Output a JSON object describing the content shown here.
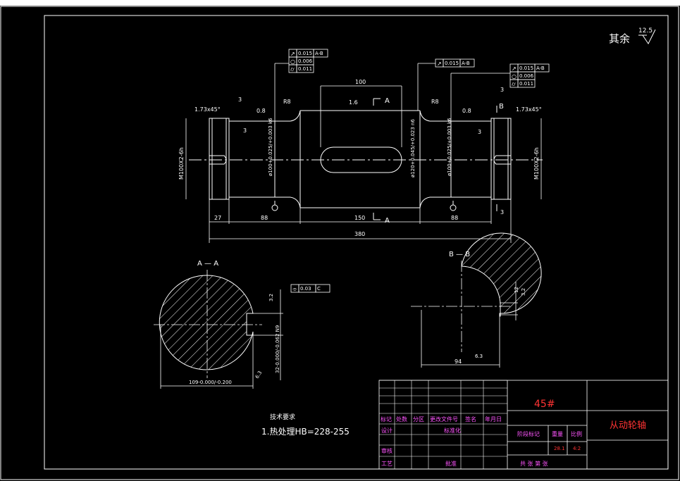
{
  "title_block": {
    "material": "45#",
    "part_name": "从动轮轴",
    "headers": [
      "标记",
      "处数",
      "分区",
      "更改文件号",
      "签名",
      "年月日"
    ],
    "design": "设计",
    "standardize": "标准化",
    "review": "审核",
    "process": "工艺",
    "approve": "批准",
    "stage_mark": "阶段标记",
    "weight": "重量",
    "scale": "比例",
    "weight_value": "28.1",
    "scale_value": "4:2",
    "sheets": "共   张   第   张"
  },
  "notes": {
    "heading": "技术要求",
    "item1": "1.热处理HB=228-255",
    "other_roughness": "其余",
    "other_roughness_value": "12.5"
  },
  "main_view": {
    "dim_total": "380",
    "dim_27": "27",
    "dim_88_left": "88",
    "dim_150": "150",
    "dim_88_right": "88",
    "dim_100": "100",
    "chamfer_left": "1.73x45°",
    "chamfer_right": "1.73x45°",
    "r8_left": "R8",
    "r8_right": "R8",
    "small3_a": "3",
    "small3_b": "3",
    "small3_c": "3",
    "small3_d": "3",
    "small3_e": "3",
    "rough_16": "1.6",
    "rough_08_left": "0.8",
    "rough_08_right": "0.8",
    "thread_left": "M100X2-6h",
    "thread_right": "M100X2-6h",
    "dia_left": "ø100+0.025/+0.003 k6",
    "dia_mid": "ø120+0.045/+0.023 n6",
    "dia_right": "ø100+0.025/+0.003 k6",
    "section_a_top": "A",
    "section_a_bottom": "A",
    "section_b": "B"
  },
  "tolerances": {
    "left": [
      [
        "↗",
        "0.015",
        "A-B"
      ],
      [
        "○",
        "0.006",
        ""
      ],
      [
        "⌭",
        "0.011",
        ""
      ]
    ],
    "middle": [
      [
        "↗",
        "0.015",
        "A-B"
      ]
    ],
    "right": [
      [
        "↗",
        "0.015",
        "A-B"
      ],
      [
        "○",
        "0.006",
        ""
      ],
      [
        "⌭",
        "0.011",
        ""
      ]
    ],
    "keyway_sym": [
      [
        "⌯",
        "0.03",
        "C"
      ]
    ]
  },
  "section_aa": {
    "label": "A — A",
    "dim_width": "109-0.000/-0.200",
    "dim_depth": "32-0.000/-0.062 N9",
    "rough_side": "3.2",
    "rough_bottom": "6.3"
  },
  "section_bb": {
    "label": "B — B",
    "dim_width": "94",
    "dim_key": "12",
    "rough_key": "3.2",
    "rough_bottom": "6.3"
  }
}
